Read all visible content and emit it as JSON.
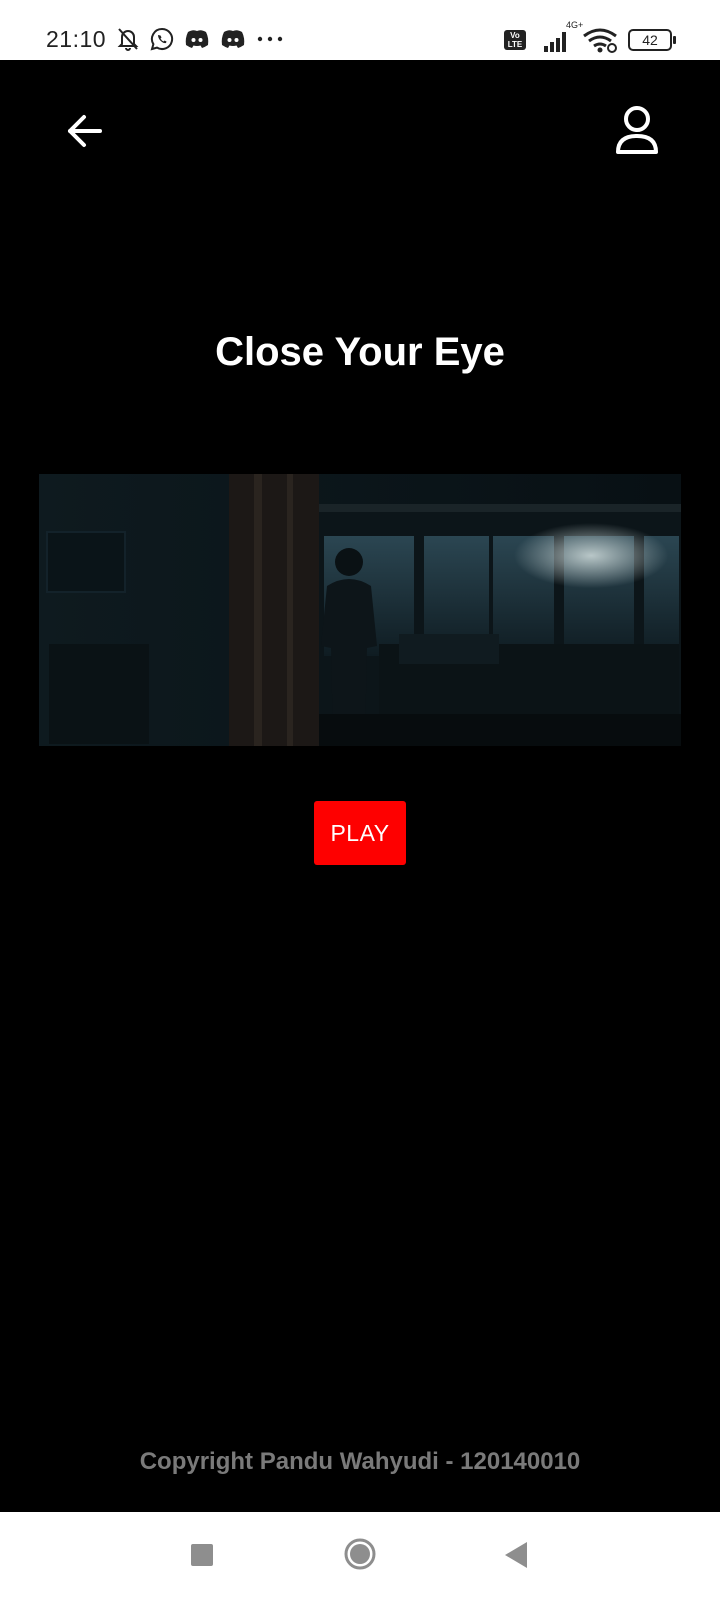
{
  "status_bar": {
    "time": "21:10",
    "network_type": "4G+",
    "volte_label": "Vo LTE",
    "battery_level": "42"
  },
  "app_bar": {
    "back_icon": "arrow-left-icon",
    "profile_icon": "user-icon"
  },
  "main": {
    "title": "Close Your Eye",
    "play_label": "PLAY"
  },
  "footer": {
    "copyright": "Copyright Pandu Wahyudi - 120140010"
  },
  "nav_bar": {
    "recent_icon": "square-icon",
    "home_icon": "circle-icon",
    "back_icon": "triangle-back-icon"
  },
  "colors": {
    "background": "#000000",
    "play_button": "#fe0000",
    "copyright_text": "#7a7a7a"
  }
}
